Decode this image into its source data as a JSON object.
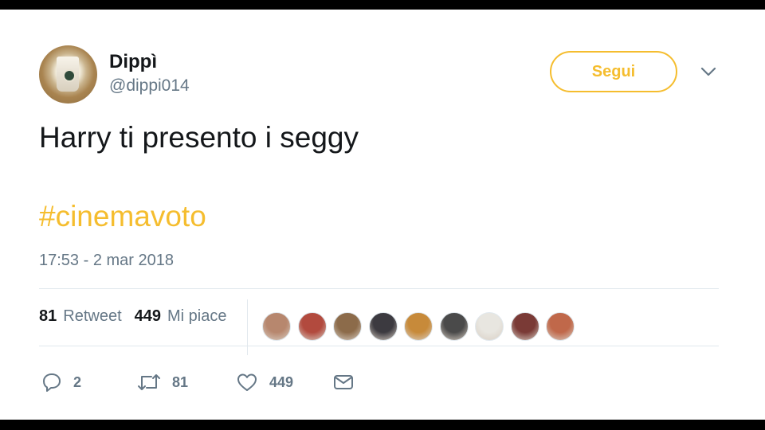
{
  "user": {
    "name": "Dippì",
    "handle": "@dippi014"
  },
  "follow_label": "Segui",
  "tweet": {
    "text": "Harry ti presento i seggy",
    "hashtag": "#cinemavoto"
  },
  "timestamp": "17:53 - 2 mar 2018",
  "stats": {
    "retweets": "81",
    "retweets_label": "Retweet",
    "likes": "449",
    "likes_label": "Mi piace"
  },
  "actions": {
    "replies": "2",
    "retweets": "81",
    "likes": "449"
  },
  "accent_color": "#f5bd2e",
  "liker_avatar_colors": [
    "#b7876e",
    "#b24a3e",
    "#8c6b4a",
    "#3c3a40",
    "#c78a3a",
    "#4a4a4a",
    "#e8e6e0",
    "#7a3a36",
    "#c0684a"
  ]
}
